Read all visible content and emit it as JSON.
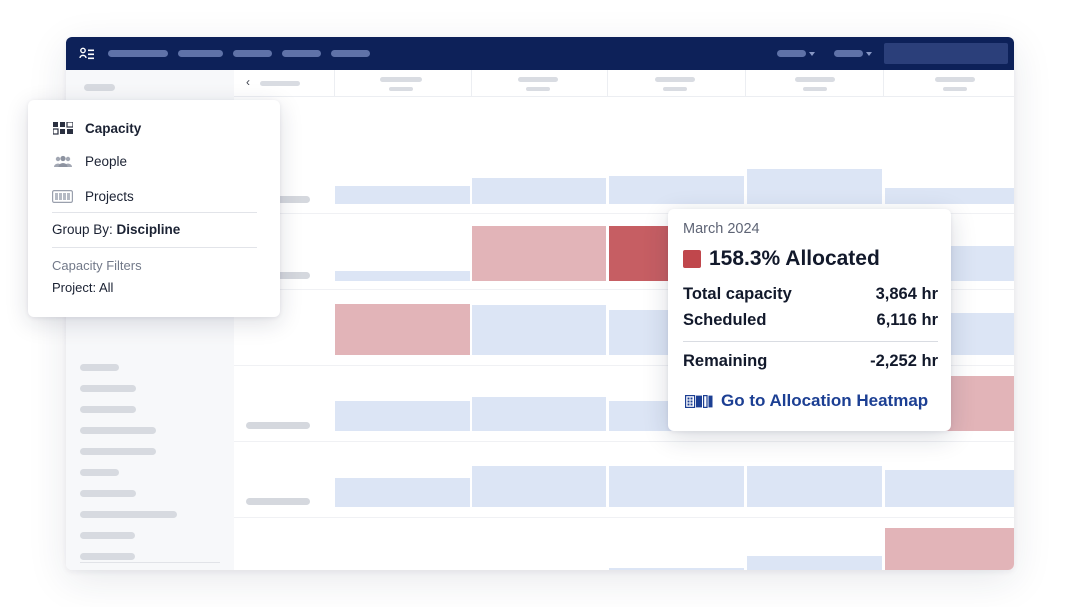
{
  "icons": {
    "app_logo": "people-list-icon",
    "back": "chevron-left-icon",
    "capacity": "capacity-grid-icon",
    "people": "people-icon",
    "projects": "projects-icon",
    "heatmap": "heatmap-icon"
  },
  "colors": {
    "topbar": "#0d2159",
    "over_allocated": "#c0474c",
    "allocated_light": "#e2b4b8",
    "available": "#dce5f5",
    "link": "#1c3f93"
  },
  "view_menu": {
    "items": [
      {
        "label": "Capacity",
        "active": true
      },
      {
        "label": "People",
        "active": false
      },
      {
        "label": "Projects",
        "active": false
      }
    ],
    "group_by_label": "Group By:",
    "group_by_value": "Discipline",
    "filters_title": "Capacity Filters",
    "filters_value": "Project: All"
  },
  "tooltip": {
    "month": "March 2024",
    "percent_allocated": "158.3% Allocated",
    "total_capacity_label": "Total capacity",
    "total_capacity_value": "3,864 hr",
    "scheduled_label": "Scheduled",
    "scheduled_value": "6,116 hr",
    "remaining_label": "Remaining",
    "remaining_value": "-2,252 hr",
    "link_label": "Go to Allocation Heatmap"
  }
}
